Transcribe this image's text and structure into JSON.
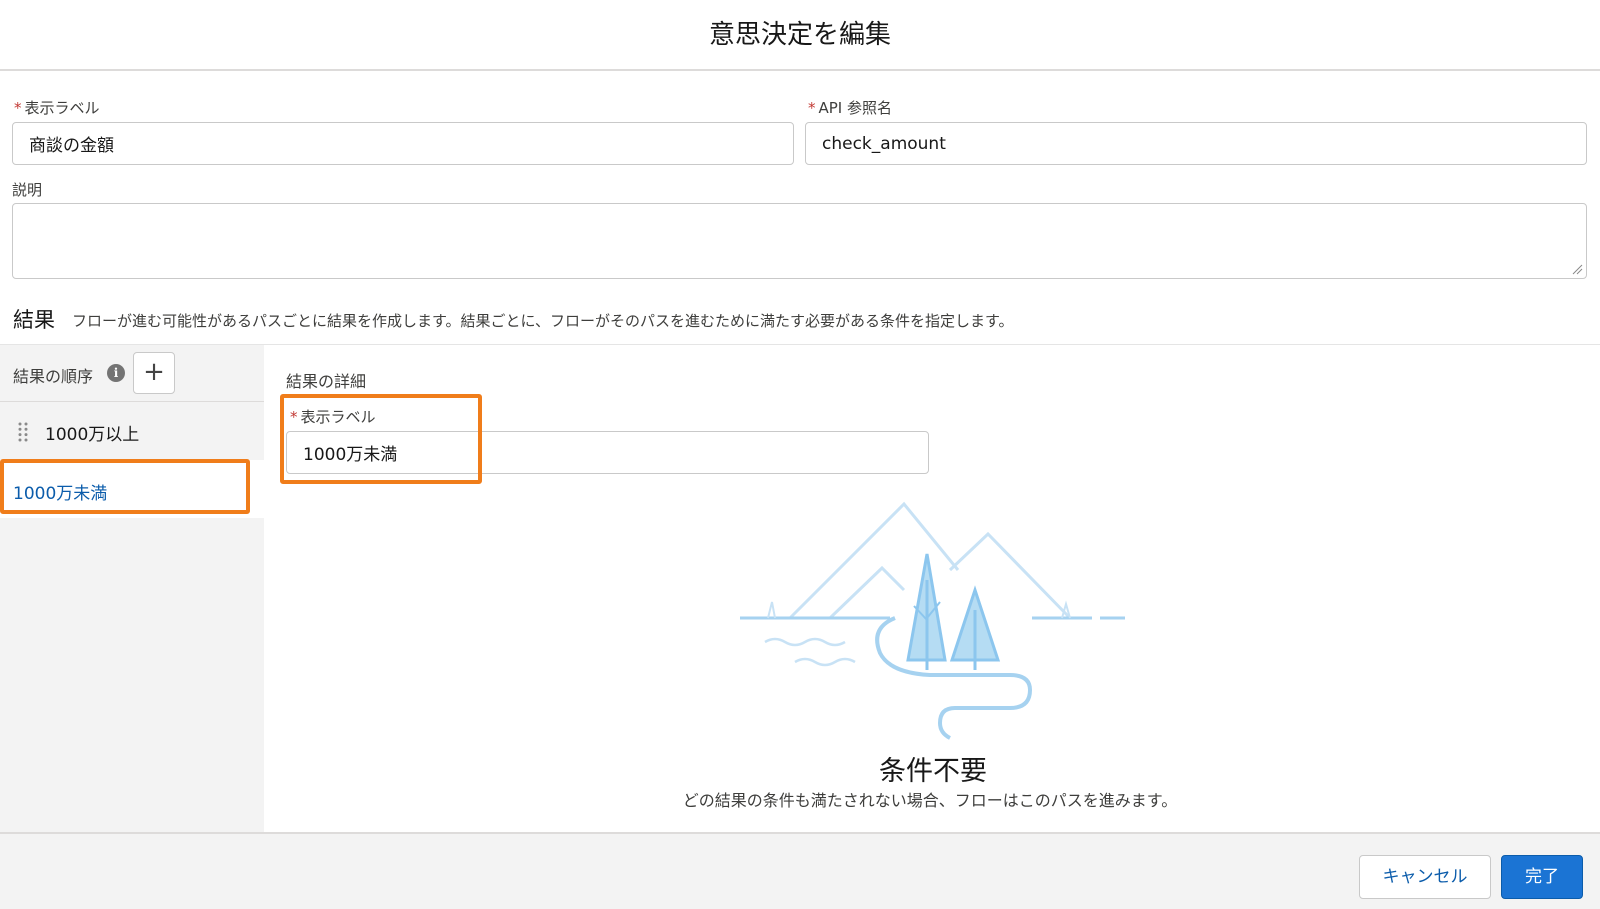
{
  "modal": {
    "title": "意思決定を編集"
  },
  "fields": {
    "label": {
      "required_mark": "*",
      "label": "表示ラベル",
      "value": "商談の金額"
    },
    "api_name": {
      "required_mark": "*",
      "label": "API 参照名",
      "value": "check_amount"
    },
    "description": {
      "label": "説明",
      "value": ""
    }
  },
  "outcomes": {
    "title": "結果",
    "description": "フローが進む可能性があるパスごとに結果を作成します。結果ごとに、フローがそのパスを進むために満たす必要がある条件を指定します。",
    "order_label": "結果の順序",
    "info_glyph": "i",
    "add_glyph": "+",
    "items": [
      {
        "label": "1000万以上"
      },
      {
        "label": "1000万未満"
      }
    ]
  },
  "detail": {
    "title": "結果の詳細",
    "label_field": {
      "required_mark": "*",
      "label": "表示ラベル",
      "value": "1000万未満"
    },
    "empty_state": {
      "title": "条件不要",
      "description": "どの結果の条件も満たされない場合、フローはこのパスを進みます。"
    }
  },
  "footer": {
    "cancel_label": "キャンセル",
    "done_label": "完了"
  },
  "colors": {
    "accent": "#1b74d4",
    "link": "#0b5cab",
    "highlight": "#f07d1a",
    "required": "#c23934"
  }
}
